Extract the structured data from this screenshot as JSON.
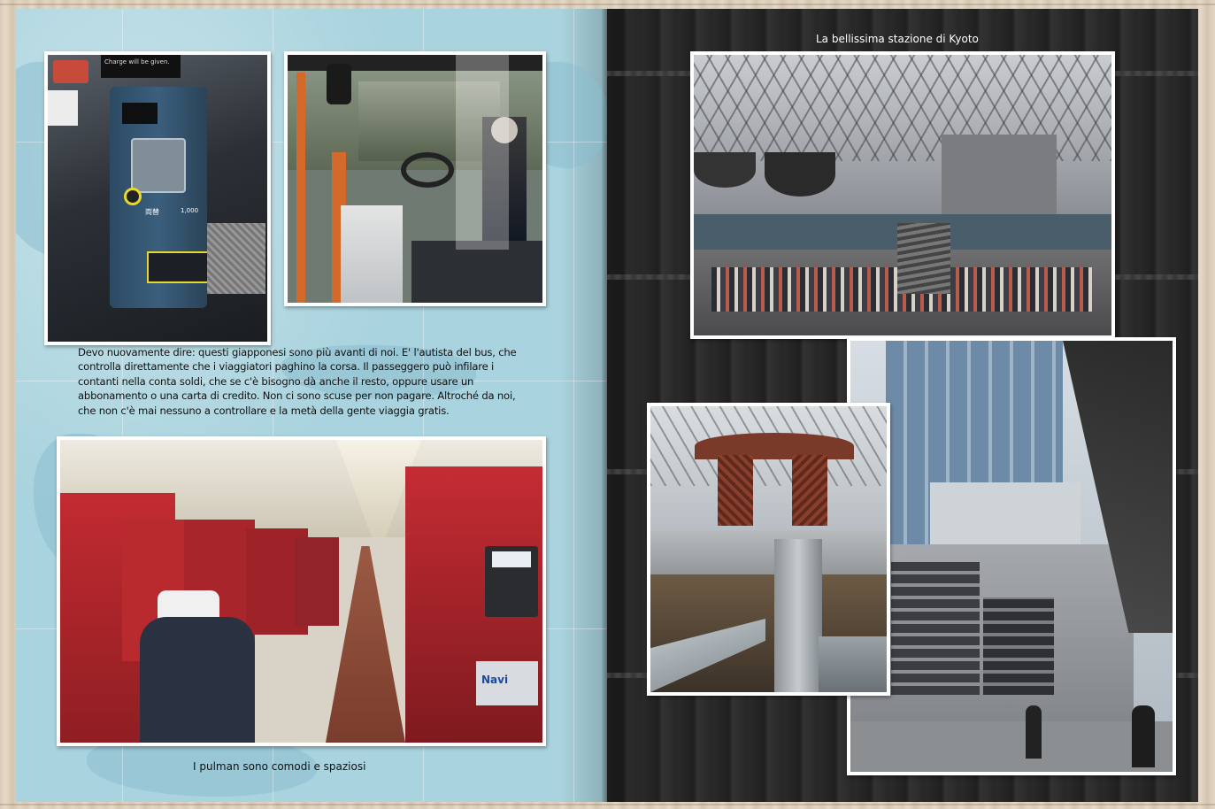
{
  "left_page": {
    "text_block": "Devo nuovamente dire: questi giapponesi sono più avanti di noi. E' l'autista del bus, che controlla direttamente che i viaggiatori paghino la corsa. Il passeggero può infilare i contanti nella conta soldi, che se c'è bisogno dà anche il resto, oppure usare un abbonamento o una carta di credito. Non ci sono scuse per non pagare. Altroché da noi, che non c'è mai nessuno a controllare e la metà della gente viaggia gratis.",
    "caption_bottom": "I pulman sono comodi e spaziosi",
    "photo_fare_machine": {
      "top_label": "Charge will be given.",
      "button_label": "両替",
      "note": "1,000"
    },
    "photo_bus_driver": {},
    "photo_train_interior": {
      "magazine_label": "Navi"
    }
  },
  "right_page": {
    "caption_top": "La bellissima stazione di Kyoto",
    "photo_station_hall": {},
    "photo_torii_gate": {},
    "photo_tower": {}
  }
}
